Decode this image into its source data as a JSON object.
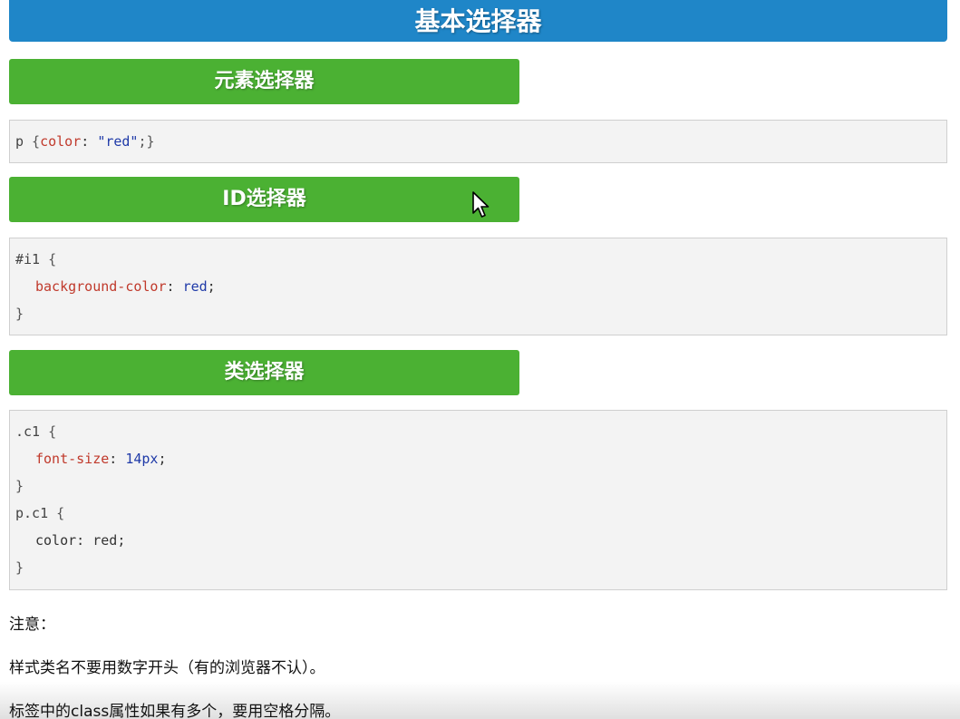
{
  "page_title": "基本选择器",
  "sections": [
    {
      "title": "元素选择器",
      "code": {
        "selector": "p",
        "prop": "color",
        "value": "\"red\""
      }
    },
    {
      "title": "ID选择器",
      "code": {
        "selector": "#i1",
        "prop": "background-color",
        "value": "red"
      }
    },
    {
      "title": "类选择器",
      "code": {
        "rule1_selector": ".c1",
        "rule1_prop": "font-size",
        "rule1_value": "14px",
        "rule2_selector": "p.c1",
        "rule2_prop": "color",
        "rule2_value": "red"
      }
    }
  ],
  "notes": {
    "heading": "注意：",
    "line1": "样式类名不要用数字开头（有的浏览器不认）。",
    "line2": "标签中的class属性如果有多个，要用空格分隔。"
  },
  "icons": {
    "cursor": "mouse-pointer-icon"
  }
}
